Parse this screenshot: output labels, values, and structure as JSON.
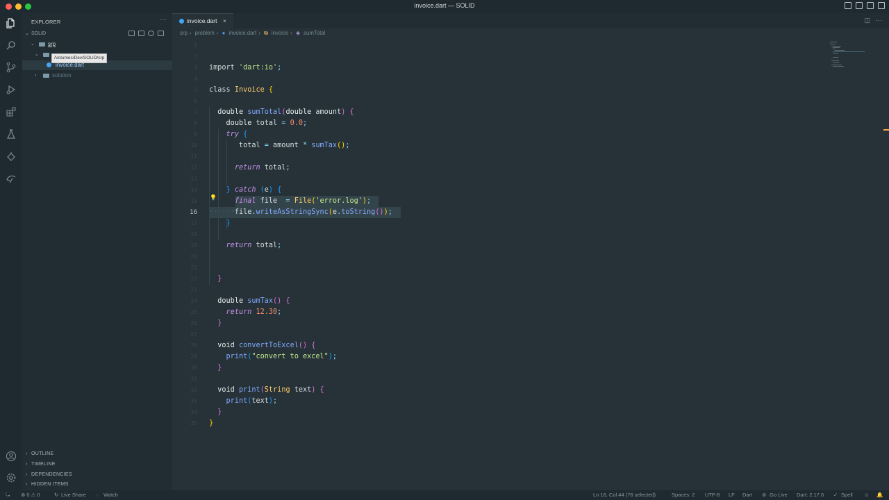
{
  "window": {
    "title": "invoice.dart — SOLID"
  },
  "activity_bar": {
    "items": [
      "explorer-icon",
      "search-icon",
      "source-control-icon",
      "run-debug-icon",
      "extensions-icon",
      "testing-icon",
      "remote-icon",
      "live-share-icon"
    ],
    "bottom": [
      "account-icon",
      "settings-gear-icon"
    ]
  },
  "sidebar": {
    "title": "EXPLORER",
    "root": "SOLID",
    "tree": [
      {
        "label": "srp",
        "type": "folder"
      },
      {
        "label": "",
        "type": "folder"
      },
      {
        "label": "invoice.dart",
        "type": "file"
      },
      {
        "label": "solution",
        "type": "folder"
      }
    ],
    "tooltip": "/Volumes/Dev/SOLID/srp",
    "panels": [
      "OUTLINE",
      "TIMELINE",
      "DEPENDENCIES",
      "HIDDEN ITEMS"
    ]
  },
  "editor": {
    "tab": {
      "label": "invoice.dart",
      "close": "×"
    },
    "breadcrumb": [
      "srp",
      "problem",
      "invoice.dart",
      "invoice",
      "sumTotal"
    ],
    "current_line": 16,
    "line_numbers": [
      "1",
      "2",
      "3",
      "4",
      "5",
      "6",
      "7",
      "8",
      "9",
      "10",
      "11",
      "12",
      "13",
      "14",
      "15",
      "16",
      "17",
      "18",
      "19",
      "20",
      "21",
      "22",
      "23",
      "24",
      "25",
      "26",
      "27",
      "28",
      "29",
      "30",
      "31",
      "32",
      "33",
      "34",
      "35"
    ]
  },
  "status_bar": {
    "remote": "⊗ 0 ⚠ 0",
    "live_share": "Live Share",
    "watch": "Watch",
    "cursor": "Ln 16, Col 44 (76 selected)",
    "spaces": "Spaces: 2",
    "encoding": "UTF-8",
    "eol": "LF",
    "language": "Dart",
    "go_live": "Go Live",
    "sdk": "Dart: 2.17.6",
    "spell": "Spell"
  },
  "colors": {
    "editor_bg": "#263238",
    "sidebar_bg": "#222d33",
    "string": "#c3e88d",
    "number": "#f78c6c",
    "function": "#82aaff",
    "class": "#ffcb6b"
  }
}
